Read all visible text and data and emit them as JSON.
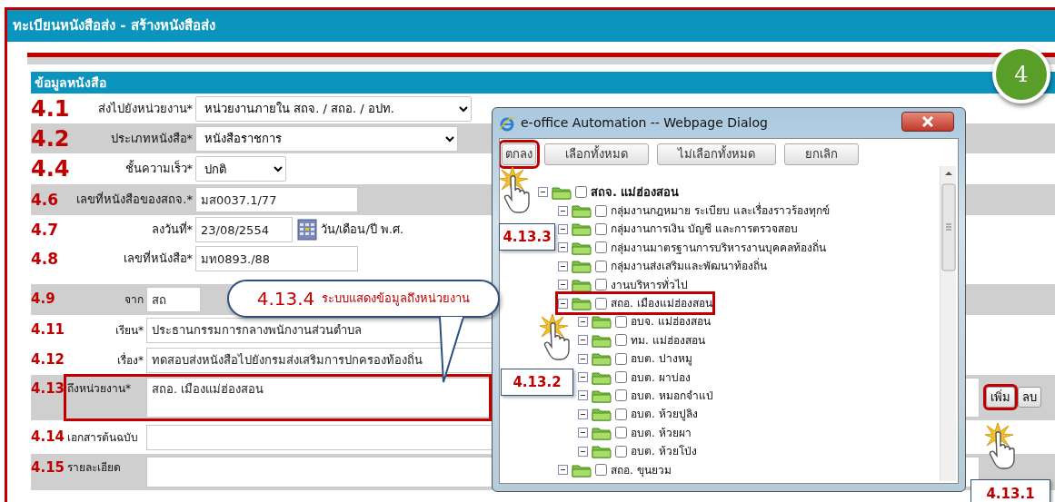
{
  "page_title": "ทะเบียนหนังสือส่ง - สร้างหนังสือส่ง",
  "step_badge": "4",
  "section_title": "ข้อมูลหนังสือ",
  "fields": [
    {
      "step": "4.1",
      "label": "ส่งไปยังหน่วยงาน*",
      "kind": "select",
      "value": "หน่วยงานภายใน สถจ. / สถอ. / อปท.",
      "shaded": false
    },
    {
      "step": "4.2",
      "label": "ประเภทหนังสือ*",
      "kind": "select",
      "value": "หนังสือราชการ",
      "shaded": true
    },
    {
      "step": "4.4",
      "label": "ชั้นความเร็ว*",
      "kind": "select",
      "value": "ปกติ",
      "shaded": false
    },
    {
      "step": "4.6",
      "label": "เลขที่หนังสือของสถจ.*",
      "kind": "text",
      "value": "มส0037.1/77",
      "shaded": true
    },
    {
      "step": "4.7",
      "label": "ลงวันที่*",
      "kind": "date",
      "value": "23/08/2554",
      "hint": "วัน/เดือน/ปี พ.ศ.",
      "shaded": false
    },
    {
      "step": "4.8",
      "label": "เลขที่หนังสือ*",
      "kind": "text",
      "value": "มท0893./88",
      "shaded": false
    }
  ],
  "recipient_fields": [
    {
      "step": "4.9",
      "label": "จาก",
      "kind": "text",
      "value": "สถ",
      "shaded": true,
      "highlighted": false
    },
    {
      "step": "4.11",
      "label": "เรียน*",
      "kind": "text",
      "value": "ประธานกรรมการกลางพนักงานส่วนตำบล",
      "shaded": false,
      "highlighted": false
    },
    {
      "step": "4.12",
      "label": "เรื่อง*",
      "kind": "text",
      "value": "ทดสอบส่งหนังสือไปยังกรมส่งเสริมการปกครองท้องถิ่น",
      "shaded": false,
      "highlighted": false
    },
    {
      "step": "4.13",
      "label": "ถึงหน่วยงาน*",
      "kind": "textarea",
      "value": "สถอ. เมืองแม่ฮ่องสอน",
      "shaded": true,
      "highlighted": true
    },
    {
      "step": "4.14",
      "label": "เอกสารต้นฉบับ",
      "kind": "text",
      "shaded": false,
      "highlighted": false
    },
    {
      "step": "4.15",
      "label": "รายละเอียด",
      "kind": "textarea",
      "shaded": true,
      "highlighted": false
    }
  ],
  "recipient_buttons": [
    {
      "label": "เพิ่ม",
      "highlighted": true
    },
    {
      "label": "ลบ",
      "highlighted": false
    }
  ],
  "dialog": {
    "title": "e-office Automation -- Webpage Dialog",
    "buttons": [
      {
        "label": "ตกลง",
        "highlighted": true
      },
      {
        "label": "เลือกทั้งหมด",
        "highlighted": false
      },
      {
        "label": "ไม่เลือกทั้งหมด",
        "highlighted": false
      },
      {
        "label": "ยกเลิก",
        "highlighted": false
      }
    ],
    "tree": [
      {
        "label": "สถจ. แม่ฮ่องสอน",
        "checked": false,
        "highlighted": false,
        "children": [
          {
            "label": "กลุ่มงานกฎหมาย ระเบียบ และเรื่องราวร้องทุกข์",
            "checked": false,
            "highlighted": false
          },
          {
            "label": "กลุ่มงานการเงิน บัญชี และการตรวจสอบ",
            "checked": false,
            "highlighted": false
          },
          {
            "label": "กลุ่มงานมาตรฐานการบริหารงานบุคคลท้องถิ่น",
            "checked": false,
            "highlighted": false
          },
          {
            "label": "กลุ่มงานส่งเสริมและพัฒนาท้องถิ่น",
            "checked": false,
            "highlighted": false
          },
          {
            "label": "งานบริหารทั่วไป",
            "checked": false,
            "highlighted": false
          },
          {
            "label": "สถอ. เมืองแม่ฮ่องสอน",
            "checked": false,
            "highlighted": true,
            "children": [
              {
                "label": "อบจ. แม่ฮ่องสอน",
                "checked": false,
                "highlighted": false
              },
              {
                "label": "ทม. แม่ฮ่องสอน",
                "checked": false,
                "highlighted": false
              },
              {
                "label": "อบต. ปางหมู",
                "checked": false,
                "highlighted": false
              },
              {
                "label": "อบต. ผาบ่อง",
                "checked": false,
                "highlighted": false
              },
              {
                "label": "อบต. หมอกจำแป่",
                "checked": false,
                "highlighted": false
              },
              {
                "label": "อบต. ห้วยปูลิง",
                "checked": false,
                "highlighted": false
              },
              {
                "label": "อบต. ห้วยผา",
                "checked": false,
                "highlighted": false
              },
              {
                "label": "อบต. ห้วยโป่ง",
                "checked": false,
                "highlighted": false
              }
            ]
          },
          {
            "label": "สถอ. ขุนยวม",
            "checked": false,
            "highlighted": false
          }
        ]
      }
    ]
  },
  "step_labels": [
    "4.13.3",
    "4.13.2",
    "4.13.1"
  ],
  "callout": {
    "step": "4.13.4",
    "text": "ระบบแสดงข้อมูลถึงหน่วยงาน"
  }
}
